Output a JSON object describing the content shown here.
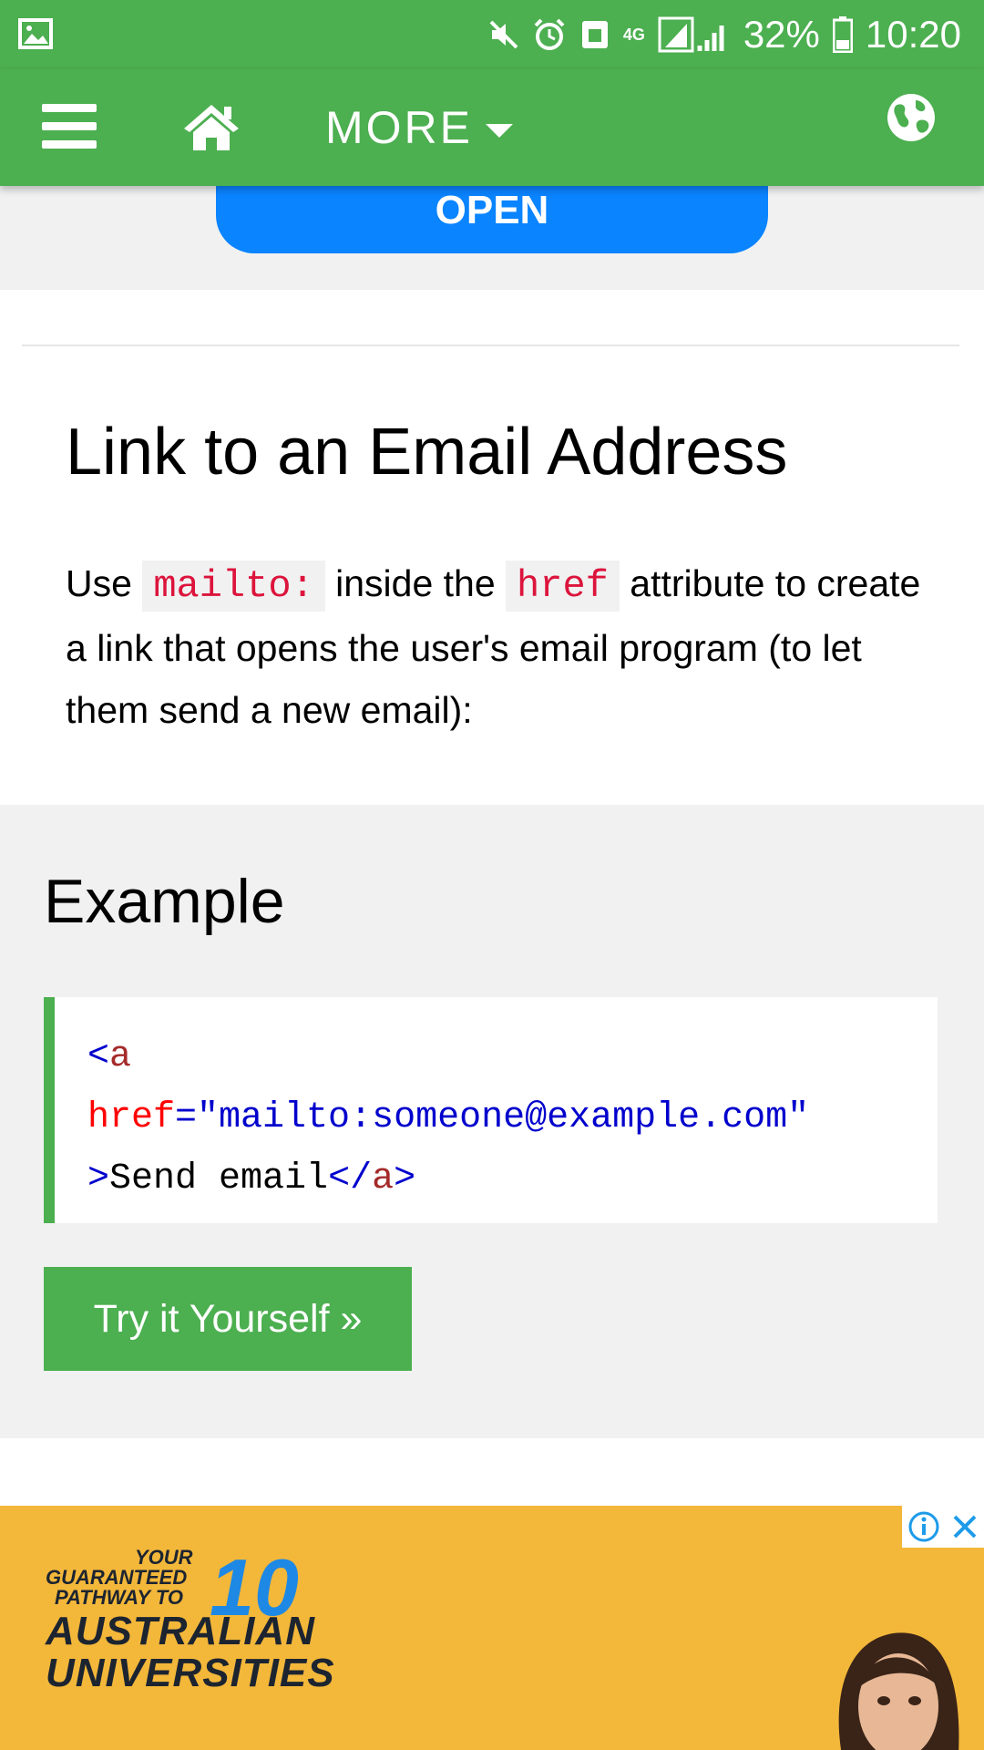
{
  "status_bar": {
    "battery": "32%",
    "time": "10:20",
    "network": "4G"
  },
  "nav": {
    "more_label": "MORE"
  },
  "open_button": "OPEN",
  "section": {
    "title": "Link to an Email Address",
    "para_1": "Use ",
    "code_1": "mailto:",
    "para_2": " inside the ",
    "code_2": "href",
    "para_3": " attribute to create a link that opens the user's email program (to let them send a new email):"
  },
  "example": {
    "title": "Example",
    "code": {
      "lt": "<",
      "tag_open": "a",
      "attr_name": "href",
      "eq": "=",
      "attr_value": "\"mailto:someone@example.com\"",
      "gt": ">",
      "text": "Send email",
      "lt_close": "</",
      "tag_close": "a",
      "gt_close": ">"
    },
    "try_button": "Try it Yourself »"
  },
  "ad": {
    "line1": "YOUR",
    "line2": "GUARANTEED",
    "line3": "PATHWAY TO",
    "number": "10",
    "line4": "AUSTRALIAN",
    "line5": "UNIVERSITIES"
  },
  "colors": {
    "w3_green": "#4caf50",
    "open_blue": "#0a84ff",
    "code_red": "#dc143c",
    "ad_yellow": "#f3b73a"
  }
}
